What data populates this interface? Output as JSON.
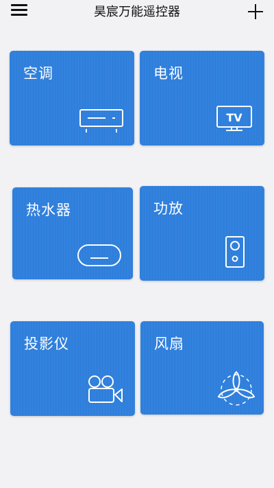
{
  "header": {
    "title": "昊宸万能遥控器"
  },
  "devices": [
    {
      "label": "空调",
      "icon": "air-conditioner-icon"
    },
    {
      "label": "电视",
      "icon": "tv-icon"
    },
    {
      "label": "热水器",
      "icon": "water-heater-icon"
    },
    {
      "label": "功放",
      "icon": "speaker-icon"
    },
    {
      "label": "投影仪",
      "icon": "projector-icon"
    },
    {
      "label": "风扇",
      "icon": "fan-icon"
    }
  ],
  "icons": {
    "tv_text": "TV"
  },
  "colors": {
    "background": "#f2f2f5",
    "tile": "#2f7fdc",
    "tile_text": "#ffffff"
  }
}
